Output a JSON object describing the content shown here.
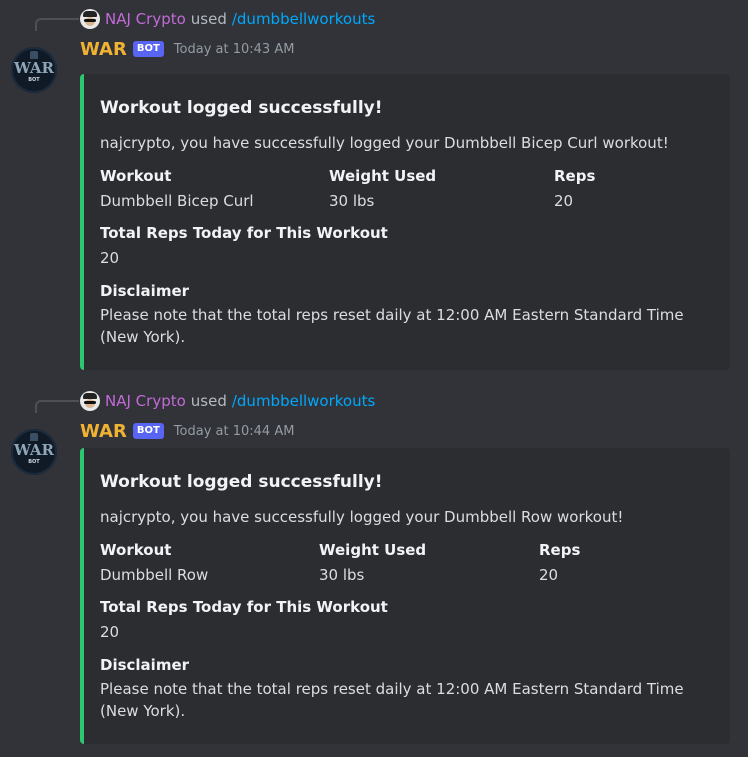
{
  "messages": [
    {
      "reply_user": "NAJ Crypto",
      "reply_used": "used",
      "reply_command": "/dumbbellworkouts",
      "avatar_text": "WAR",
      "avatar_sub": "BOT",
      "username": "WAR",
      "bot_tag": "BOT",
      "timestamp": "Today at 10:43 AM",
      "embed": {
        "title": "Workout logged successfully!",
        "description": "najcrypto, you have successfully logged your Dumbbell Bicep Curl workout!",
        "fields": [
          {
            "name": "Workout",
            "value": "Dumbbell Bicep Curl"
          },
          {
            "name": "Weight Used",
            "value": "30 lbs"
          },
          {
            "name": "Reps",
            "value": "20"
          },
          {
            "name": "Total Reps Today for This Workout",
            "value": "20"
          },
          {
            "name": "Disclaimer",
            "value": "Please note that the total reps reset daily at 12:00 AM Eastern Standard Time (New York)."
          }
        ],
        "accent_color": "#2dc770"
      }
    },
    {
      "reply_user": "NAJ Crypto",
      "reply_used": "used",
      "reply_command": "/dumbbellworkouts",
      "avatar_text": "WAR",
      "avatar_sub": "BOT",
      "username": "WAR",
      "bot_tag": "BOT",
      "timestamp": "Today at 10:44 AM",
      "embed": {
        "title": "Workout logged successfully!",
        "description": "najcrypto, you have successfully logged your Dumbbell Row workout!",
        "fields": [
          {
            "name": "Workout",
            "value": "Dumbbell Row"
          },
          {
            "name": "Weight Used",
            "value": "30 lbs"
          },
          {
            "name": "Reps",
            "value": "20"
          },
          {
            "name": "Total Reps Today for This Workout",
            "value": "20"
          },
          {
            "name": "Disclaimer",
            "value": "Please note that the total reps reset daily at 12:00 AM Eastern Standard Time (New York)."
          }
        ],
        "accent_color": "#2dc770"
      }
    }
  ],
  "colors": {
    "background": "#313338",
    "embed_bg": "#2b2d31",
    "bot_username": "#f0b232",
    "reply_username": "#c36ad8",
    "command_link": "#00a8fc",
    "bot_tag_bg": "#5865f2"
  }
}
